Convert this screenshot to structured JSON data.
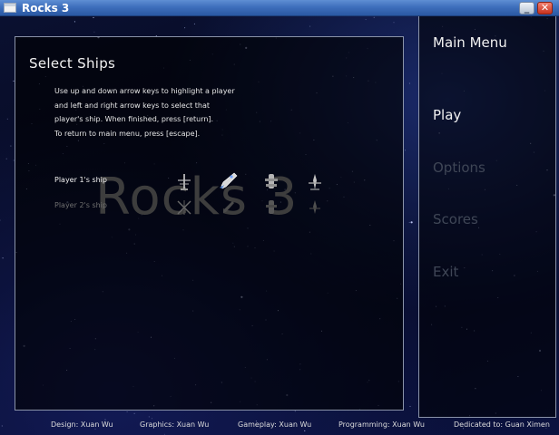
{
  "window": {
    "title": "Rocks 3",
    "minimize_symbol": "_",
    "close_symbol": "✕"
  },
  "select_panel": {
    "title": "Select Ships",
    "instructions": [
      "Use up and down arrow keys to highlight a player",
      "and left and right arrow keys to select that",
      "player's ship.  When finished, press [return].",
      "To return to main menu, press [escape]."
    ],
    "watermark": "Rocks 3",
    "players": [
      {
        "label": "Player 1's ship",
        "highlighted": true,
        "selected_ship": 2
      },
      {
        "label": "Player 2's ship",
        "highlighted": false,
        "selected_ship": null
      }
    ],
    "ship_icons": [
      "ship-a-icon",
      "ship-b-icon",
      "ship-c-icon",
      "ship-d-icon"
    ]
  },
  "menu": {
    "title": "Main Menu",
    "items": [
      {
        "label": "Play",
        "active": true
      },
      {
        "label": "Options",
        "active": false
      },
      {
        "label": "Scores",
        "active": false
      },
      {
        "label": "Exit",
        "active": false
      }
    ]
  },
  "credits": [
    "Design: Xuan Wu",
    "Graphics: Xuan Wu",
    "Gameplay: Xuan Wu",
    "Programming: Xuan Wu",
    "Dedicated to: Guan Ximen"
  ],
  "colors": {
    "menu_active": "#f2f2f2",
    "menu_inactive": "#3f4656",
    "title_bar": "#3e6fbc",
    "panel_border": "#8a93a8"
  }
}
